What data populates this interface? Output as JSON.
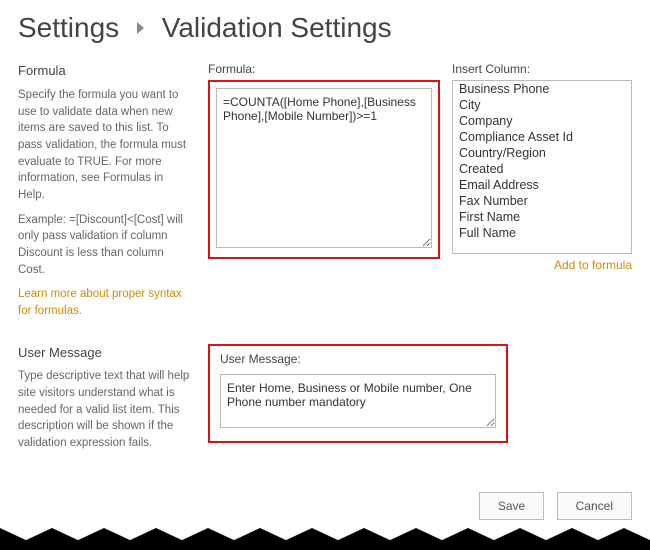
{
  "breadcrumb": {
    "root": "Settings",
    "page": "Validation Settings"
  },
  "formula_section": {
    "heading": "Formula",
    "desc1": "Specify the formula you want to use to validate data when new items are saved to this list. To pass validation, the formula must evaluate to TRUE. For more information, see Formulas in Help.",
    "desc2": "Example: =[Discount]<[Cost] will only pass validation if column Discount is less than column Cost.",
    "link": "Learn more about proper syntax for formulas.",
    "formula_label": "Formula:",
    "formula_value": "=COUNTA([Home Phone],[Business Phone],[Mobile Number])>=1",
    "insert_label": "Insert Column:",
    "columns": [
      "Business Phone",
      "City",
      "Company",
      "Compliance Asset Id",
      "Country/Region",
      "Created",
      "Email Address",
      "Fax Number",
      "First Name",
      "Full Name"
    ],
    "add_link": "Add to formula"
  },
  "usermsg_section": {
    "heading": "User Message",
    "desc": "Type descriptive text that will help site visitors understand what is needed for a valid list item. This description will be shown if the validation expression fails.",
    "label": "User Message:",
    "value": "Enter Home, Business or Mobile number, One Phone number mandatory"
  },
  "buttons": {
    "save": "Save",
    "cancel": "Cancel"
  }
}
